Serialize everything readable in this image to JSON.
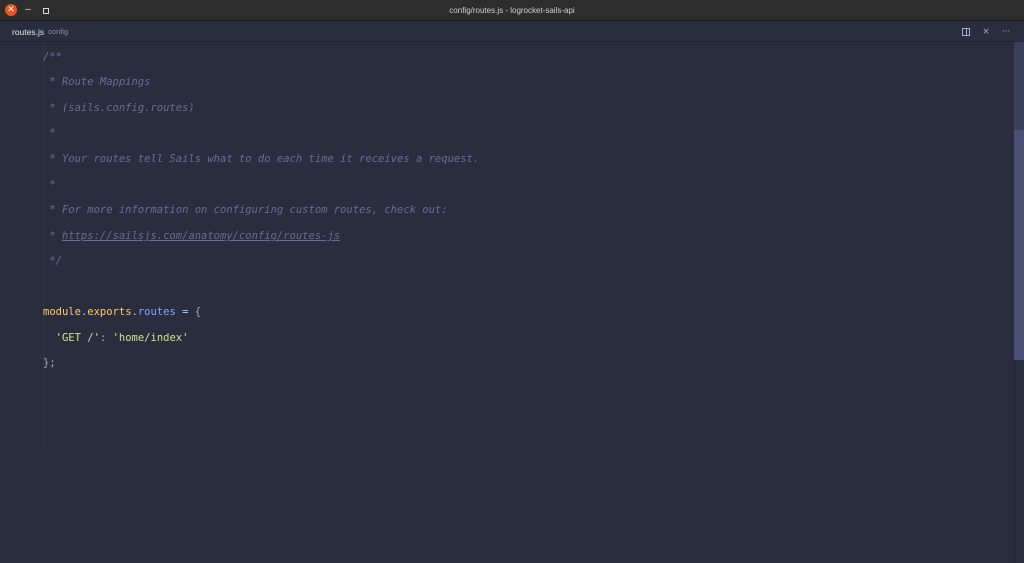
{
  "window": {
    "title": "config/routes.js - logrocket-sails-api",
    "close_glyph": "✕",
    "minimize_glyph": "–"
  },
  "tab": {
    "name": "routes.js",
    "path": "config"
  },
  "tab_actions": {
    "close_glyph": "×",
    "more_glyph": "···"
  },
  "editor": {
    "comment_lines": [
      "/**",
      " * Route Mappings",
      " * (sails.config.routes)",
      " *",
      " * Your routes tell Sails what to do each time it receives a request.",
      " *",
      " * For more information on configuring custom routes, check out:",
      " * ",
      " */"
    ],
    "url": "https://sailsjs.com/anatomy/config/routes-js",
    "code": {
      "module": "module",
      "dot1": ".",
      "exports": "exports",
      "dot2": ".",
      "routes": "routes",
      "assign": " = ",
      "open_brace": "{",
      "route_key": "  'GET /'",
      "colon": ": ",
      "route_value": "'home/index'",
      "close": "};"
    }
  },
  "colors": {
    "background": "#292d3e",
    "comment": "#676e95",
    "variable": "#ffcb6b",
    "property": "#82aaff",
    "string": "#c3e88d",
    "punctuation": "#89ddff"
  }
}
